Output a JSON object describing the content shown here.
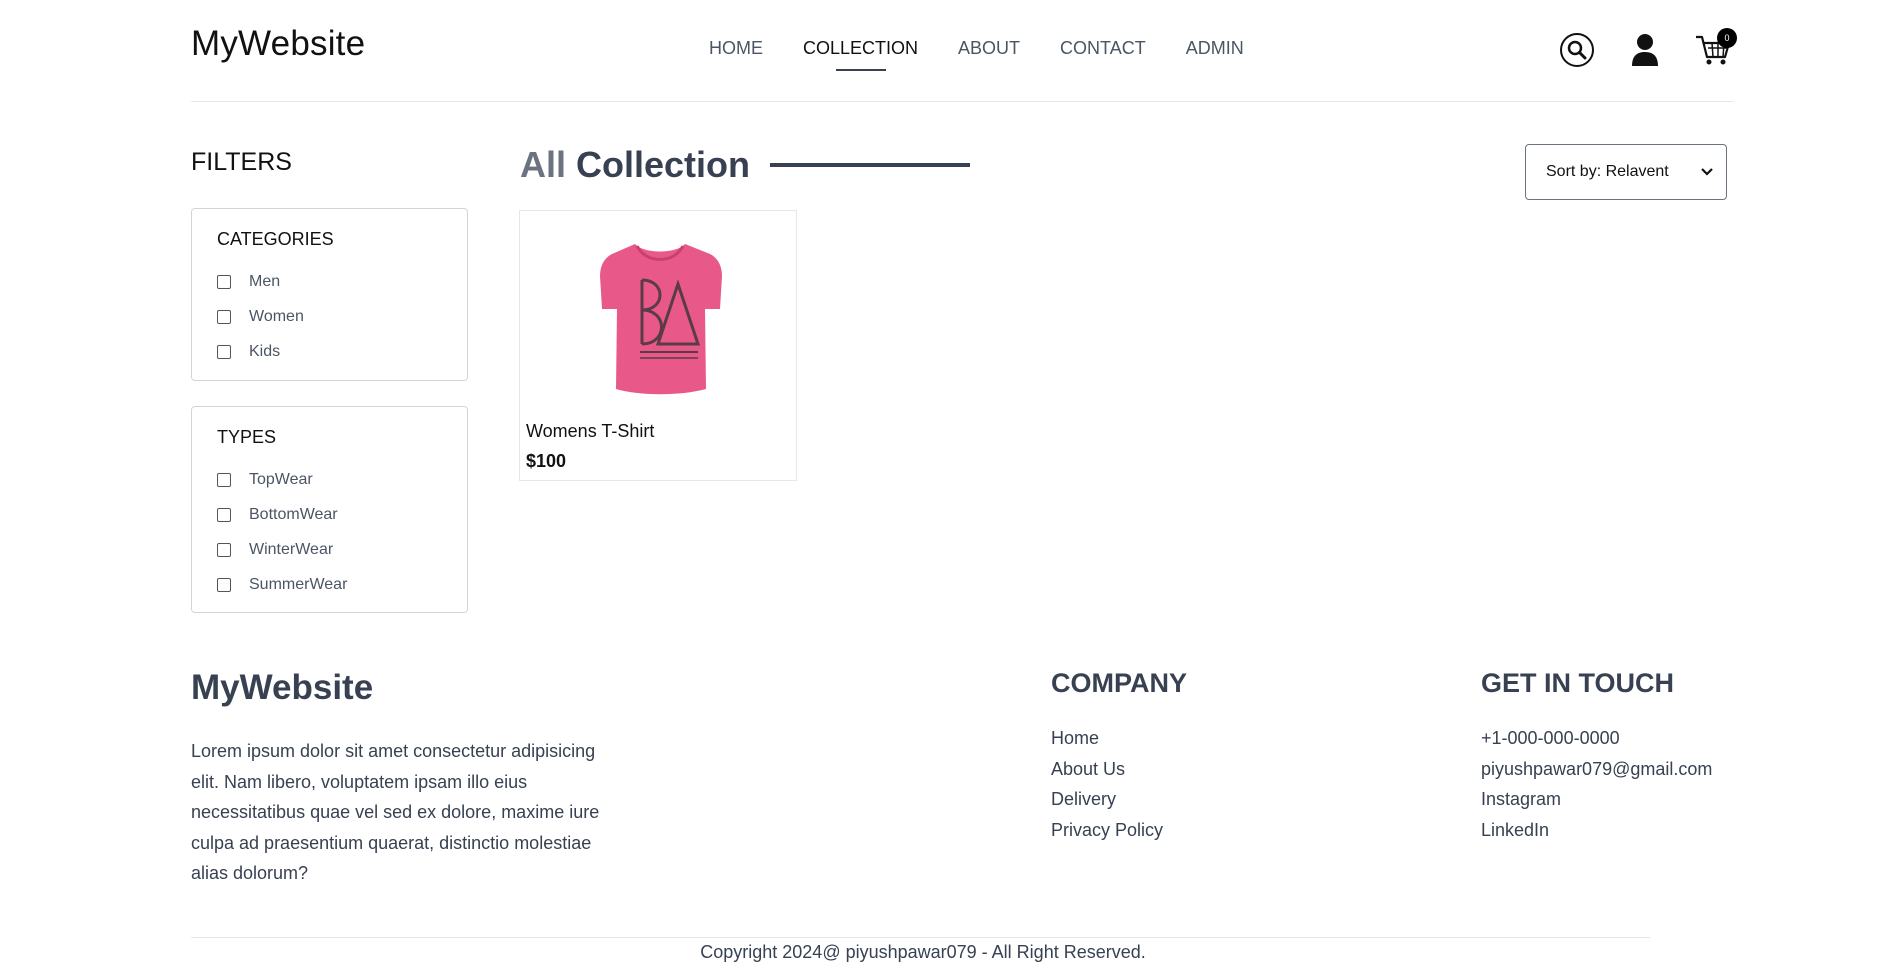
{
  "header": {
    "logo": "MyWebsite",
    "nav": [
      {
        "label": "HOME",
        "active": false
      },
      {
        "label": "COLLECTION",
        "active": true
      },
      {
        "label": "ABOUT",
        "active": false
      },
      {
        "label": "CONTACT",
        "active": false
      },
      {
        "label": "ADMIN",
        "active": false
      }
    ],
    "icons": {
      "search": "search-icon",
      "profile": "user-icon",
      "cart": "cart-icon"
    },
    "cart_count": "0"
  },
  "filters": {
    "title": "FILTERS",
    "categories": {
      "heading": "CATEGORIES",
      "options": [
        "Men",
        "Women",
        "Kids"
      ]
    },
    "types": {
      "heading": "TYPES",
      "options": [
        "TopWear",
        "BottomWear",
        "WinterWear",
        "SummerWear"
      ]
    }
  },
  "collection": {
    "title_prefix": "All",
    "title_main": "Collection",
    "sort_label": "Sort by: Relavent",
    "products": [
      {
        "name": "Womens T-Shirt",
        "price": "$100",
        "image_color": "#e8598a"
      }
    ]
  },
  "footer": {
    "logo": "MyWebsite",
    "about": "Lorem ipsum dolor sit amet consectetur adipisicing elit. Nam libero, voluptatem ipsam illo eius necessitatibus quae vel sed ex dolore, maxime iure culpa ad praesentium quaerat, distinctio molestiae alias dolorum?",
    "company": {
      "heading": "COMPANY",
      "links": [
        "Home",
        "About Us",
        "Delivery",
        "Privacy Policy"
      ]
    },
    "contact": {
      "heading": "GET IN TOUCH",
      "items": [
        "+1-000-000-0000",
        "piyushpawar079@gmail.com",
        "Instagram",
        "LinkedIn"
      ]
    },
    "copyright": "Copyright 2024@ piyushpawar079 - All Right Reserved."
  },
  "colors": {
    "accent": "#374151",
    "product_pink": "#e8598a"
  }
}
